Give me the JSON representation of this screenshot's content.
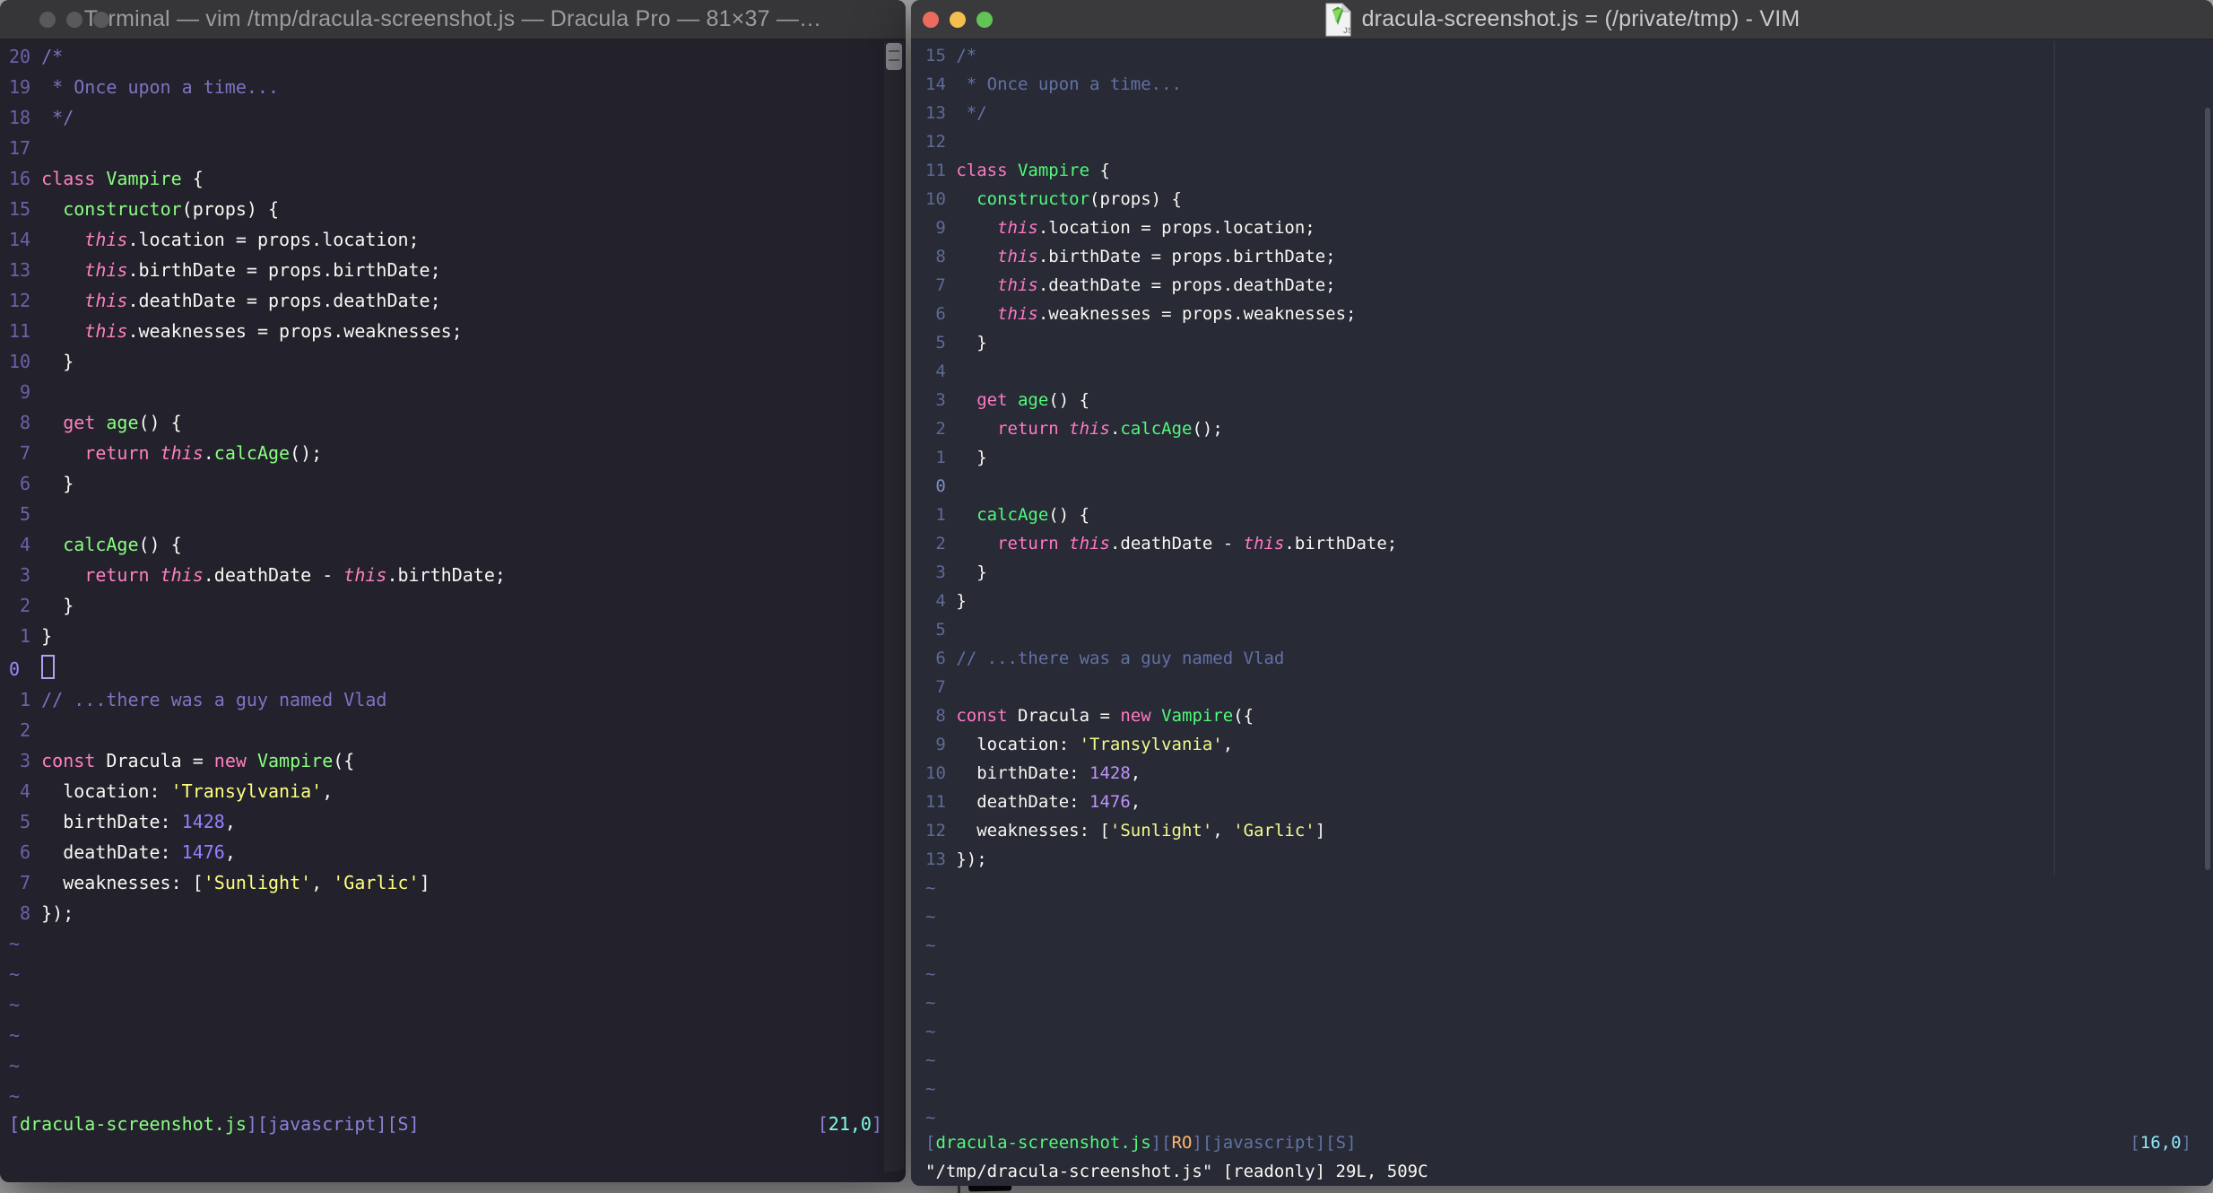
{
  "shared_code": [
    [
      {
        "t": "/*",
        "c": "c"
      }
    ],
    [
      {
        "t": " * Once upon a time...",
        "c": "c"
      }
    ],
    [
      {
        "t": " */",
        "c": "c"
      }
    ],
    [],
    [
      {
        "t": "class",
        "c": "p"
      },
      {
        "t": " ",
        "c": "f"
      },
      {
        "t": "Vampire",
        "c": "g"
      },
      {
        "t": " {",
        "c": "f"
      }
    ],
    [
      {
        "t": "  ",
        "c": "f"
      },
      {
        "t": "constructor",
        "c": "g"
      },
      {
        "t": "(props) {",
        "c": "f"
      }
    ],
    [
      {
        "t": "    ",
        "c": "f"
      },
      {
        "t": "this",
        "c": "i"
      },
      {
        "t": ".location = props.location;",
        "c": "f"
      }
    ],
    [
      {
        "t": "    ",
        "c": "f"
      },
      {
        "t": "this",
        "c": "i"
      },
      {
        "t": ".birthDate = props.birthDate;",
        "c": "f"
      }
    ],
    [
      {
        "t": "    ",
        "c": "f"
      },
      {
        "t": "this",
        "c": "i"
      },
      {
        "t": ".deathDate = props.deathDate;",
        "c": "f"
      }
    ],
    [
      {
        "t": "    ",
        "c": "f"
      },
      {
        "t": "this",
        "c": "i"
      },
      {
        "t": ".weaknesses = props.weaknesses;",
        "c": "f"
      }
    ],
    [
      {
        "t": "  }",
        "c": "f"
      }
    ],
    [],
    [
      {
        "t": "  ",
        "c": "f"
      },
      {
        "t": "get",
        "c": "p"
      },
      {
        "t": " ",
        "c": "f"
      },
      {
        "t": "age",
        "c": "g"
      },
      {
        "t": "() {",
        "c": "f"
      }
    ],
    [
      {
        "t": "    ",
        "c": "f"
      },
      {
        "t": "return",
        "c": "p"
      },
      {
        "t": " ",
        "c": "f"
      },
      {
        "t": "this",
        "c": "i"
      },
      {
        "t": ".",
        "c": "f"
      },
      {
        "t": "calcAge",
        "c": "g"
      },
      {
        "t": "();",
        "c": "f"
      }
    ],
    [
      {
        "t": "  }",
        "c": "f"
      }
    ],
    [],
    [
      {
        "t": "  ",
        "c": "f"
      },
      {
        "t": "calcAge",
        "c": "g"
      },
      {
        "t": "() {",
        "c": "f"
      }
    ],
    [
      {
        "t": "    ",
        "c": "f"
      },
      {
        "t": "return",
        "c": "p"
      },
      {
        "t": " ",
        "c": "f"
      },
      {
        "t": "this",
        "c": "i"
      },
      {
        "t": ".deathDate - ",
        "c": "f"
      },
      {
        "t": "this",
        "c": "i"
      },
      {
        "t": ".birthDate;",
        "c": "f"
      }
    ],
    [
      {
        "t": "  }",
        "c": "f"
      }
    ],
    [
      {
        "t": "}",
        "c": "f"
      }
    ],
    [],
    [
      {
        "t": "// ...there was a guy named Vlad",
        "c": "c"
      }
    ],
    [],
    [
      {
        "t": "const",
        "c": "p"
      },
      {
        "t": " Dracula = ",
        "c": "f"
      },
      {
        "t": "new",
        "c": "p"
      },
      {
        "t": " ",
        "c": "f"
      },
      {
        "t": "Vampire",
        "c": "g"
      },
      {
        "t": "({",
        "c": "f"
      }
    ],
    [
      {
        "t": "  location: ",
        "c": "f"
      },
      {
        "t": "'Transylvania'",
        "c": "y"
      },
      {
        "t": ",",
        "c": "f"
      }
    ],
    [
      {
        "t": "  birthDate: ",
        "c": "f"
      },
      {
        "t": "1428",
        "c": "n"
      },
      {
        "t": ",",
        "c": "f"
      }
    ],
    [
      {
        "t": "  deathDate: ",
        "c": "f"
      },
      {
        "t": "1476",
        "c": "n"
      },
      {
        "t": ",",
        "c": "f"
      }
    ],
    [
      {
        "t": "  weaknesses: [",
        "c": "f"
      },
      {
        "t": "'Sunlight'",
        "c": "y"
      },
      {
        "t": ", ",
        "c": "f"
      },
      {
        "t": "'Garlic'",
        "c": "y"
      },
      {
        "t": "]",
        "c": "f"
      }
    ],
    [
      {
        "t": "});",
        "c": "f"
      }
    ]
  ],
  "windows": [
    {
      "id": "left",
      "app": "Terminal",
      "title": "Terminal — vim /tmp/dracula-screenshot.js — Dracula Pro — 81×37 —…",
      "active": false,
      "traffic_lights": [
        "#59595D",
        "#59595D",
        "#59595D"
      ],
      "numbers": [
        "20",
        "19",
        "18",
        "17",
        "16",
        "15",
        "14",
        "13",
        "12",
        "11",
        "10",
        "9",
        "8",
        "7",
        "6",
        "5",
        "4",
        "3",
        "2",
        "1",
        "0",
        "1",
        "2",
        "3",
        "4",
        "5",
        "6",
        "7",
        "8"
      ],
      "cursor_line": 20,
      "cursor_visible": true,
      "tildes": 6,
      "status_left": [
        {
          "t": "[",
          "c": "br"
        },
        {
          "t": "dracula-screenshot.js",
          "c": "gr"
        },
        {
          "t": "][",
          "c": "br"
        },
        {
          "t": "javascript",
          "c": "br"
        },
        {
          "t": "][",
          "c": "br"
        },
        {
          "t": "S",
          "c": "br"
        },
        {
          "t": "]",
          "c": "br"
        }
      ],
      "status_right": [
        {
          "t": "[",
          "c": "br"
        },
        {
          "t": "21,0",
          "c": "cy"
        },
        {
          "t": "]",
          "c": "br"
        }
      ],
      "cmdline": "",
      "palette": {
        "bg": "#22212C",
        "fg": "#F8F8F2",
        "comment": "#7D74C2",
        "pink": "#FF80BF",
        "green": "#8AFF80",
        "yellow": "#FFFF80",
        "purple": "#9580FF",
        "cyan": "#80FFEA",
        "line_number": "#6B63A8",
        "current_line_number": "#9A8CFF"
      }
    },
    {
      "id": "right",
      "app": "VIM",
      "title": "dracula-screenshot.js = (/private/tmp) - VIM",
      "active": true,
      "traffic_lights": [
        "#ED6A5E",
        "#F5BF4F",
        "#61C454"
      ],
      "numbers": [
        "15",
        "14",
        "13",
        "12",
        "11",
        "10",
        "9",
        "8",
        "7",
        "6",
        "5",
        "4",
        "3",
        "2",
        "1",
        "0",
        "1",
        "2",
        "3",
        "4",
        "5",
        "6",
        "7",
        "8",
        "9",
        "10",
        "11",
        "12",
        "13"
      ],
      "cursor_line": 15,
      "cursor_visible": false,
      "tildes": 9,
      "status_left": [
        {
          "t": "[",
          "c": "br"
        },
        {
          "t": "dracula-screenshot.js",
          "c": "gr"
        },
        {
          "t": "][",
          "c": "br"
        },
        {
          "t": "RO",
          "c": "or"
        },
        {
          "t": "][",
          "c": "br"
        },
        {
          "t": "javascript",
          "c": "br"
        },
        {
          "t": "][",
          "c": "br"
        },
        {
          "t": "S",
          "c": "br"
        },
        {
          "t": "]",
          "c": "br"
        }
      ],
      "status_right": [
        {
          "t": "[",
          "c": "br"
        },
        {
          "t": "16,0",
          "c": "cy"
        },
        {
          "t": "]",
          "c": "br"
        }
      ],
      "cmdline": "\"/tmp/dracula-screenshot.js\" [readonly] 29L, 509C",
      "palette": {
        "bg": "#282A36",
        "fg": "#F8F8F2",
        "comment": "#6272A4",
        "pink": "#FF79C6",
        "green": "#50FA7B",
        "yellow": "#F1FA8C",
        "purple": "#BD93F9",
        "cyan": "#8BE9FD",
        "orange": "#FFB86C",
        "line_number": "#5F6B94",
        "current_line_number": "#7D8FC0"
      }
    }
  ]
}
